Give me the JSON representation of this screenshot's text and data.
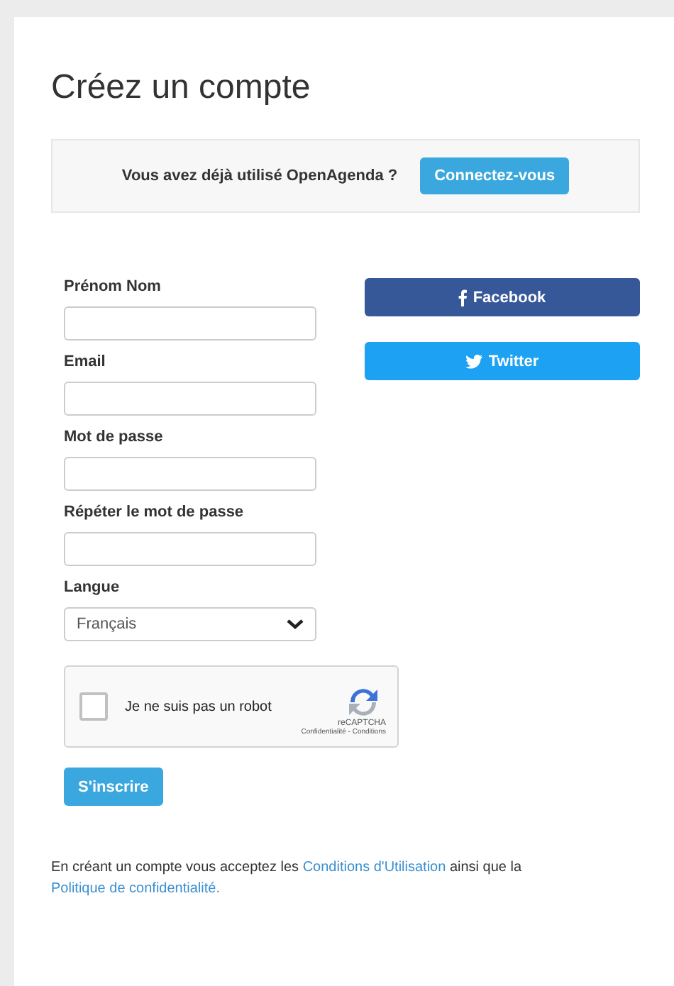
{
  "title": "Créez un compte",
  "banner": {
    "text": "Vous avez déjà utilisé OpenAgenda ?",
    "button": "Connectez-vous"
  },
  "fields": [
    {
      "kind": "text",
      "label": "Prénom Nom"
    },
    {
      "kind": "text",
      "label": "Email"
    },
    {
      "kind": "password",
      "label": "Mot de passe"
    },
    {
      "kind": "password",
      "label": "Répéter le mot de passe"
    },
    {
      "kind": "select",
      "label": "Langue",
      "value": "Français"
    }
  ],
  "social": [
    {
      "kind": "facebook",
      "label": "Facebook"
    },
    {
      "kind": "twitter",
      "label": "Twitter"
    }
  ],
  "captcha": {
    "label": "Je ne suis pas un robot",
    "checked": false,
    "brand": "reCAPTCHA",
    "links": "Confidentialité - Conditions"
  },
  "submit": "S'inscrire",
  "terms": [
    {
      "text": "En créant un compte vous acceptez les ",
      "link": false
    },
    {
      "text": "Conditions d'Utilisation",
      "link": true
    },
    {
      "text": " ainsi que la ",
      "link": false
    },
    {
      "text": "Politique de confidentialité.",
      "link": true
    }
  ]
}
